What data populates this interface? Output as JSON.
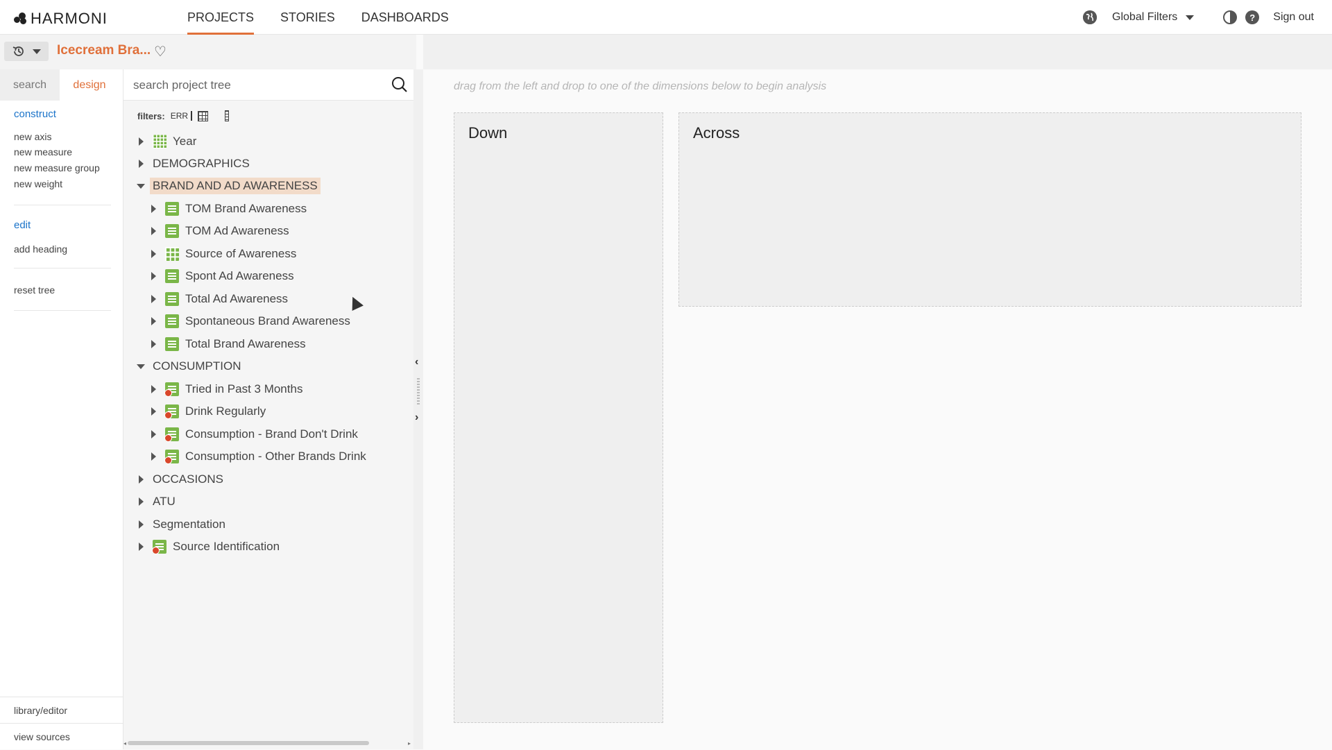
{
  "app": {
    "logo_text": "HARMONI",
    "nav": [
      {
        "label": "PROJECTS",
        "active": true
      },
      {
        "label": "STORIES",
        "active": false
      },
      {
        "label": "DASHBOARDS",
        "active": false
      }
    ],
    "global_filters_label": "Global Filters",
    "sign_out_label": "Sign out",
    "accent_color": "#e0703a",
    "icons": [
      "globe-icon",
      "contrast-icon",
      "help-icon",
      "history-icon",
      "heart-icon",
      "search-icon"
    ]
  },
  "project": {
    "title": "Icecream Bra..."
  },
  "rail": {
    "tabs": [
      {
        "label": "search",
        "active": false
      },
      {
        "label": "design",
        "active": true
      }
    ],
    "construct_label": "construct",
    "construct_items": [
      "new axis",
      "new measure",
      "new measure group",
      "new weight"
    ],
    "edit_label": "edit",
    "edit_items": [
      "add heading"
    ],
    "reset_label": "reset tree",
    "bottom_items": [
      "library/editor",
      "view sources"
    ]
  },
  "tree": {
    "search_placeholder": "search project tree",
    "filters_label": "filters:",
    "filter_err": "ERR",
    "items": [
      {
        "label": "Year",
        "level": 0,
        "expanded": false,
        "icon": "calendar-icon"
      },
      {
        "label": "DEMOGRAPHICS",
        "level": 0,
        "expanded": false,
        "icon": ""
      },
      {
        "label": "BRAND AND AD AWARENESS",
        "level": 0,
        "expanded": true,
        "icon": "",
        "selected": true
      },
      {
        "label": "TOM Brand Awareness",
        "level": 1,
        "expanded": false,
        "icon": "measure-icon"
      },
      {
        "label": "TOM Ad Awareness",
        "level": 1,
        "expanded": false,
        "icon": "measure-icon"
      },
      {
        "label": "Source of Awareness",
        "level": 1,
        "expanded": false,
        "icon": "grid-measure-icon"
      },
      {
        "label": "Spont Ad Awareness",
        "level": 1,
        "expanded": false,
        "icon": "measure-icon"
      },
      {
        "label": "Total Ad Awareness",
        "level": 1,
        "expanded": false,
        "icon": "measure-icon"
      },
      {
        "label": "Spontaneous Brand Awareness",
        "level": 1,
        "expanded": false,
        "icon": "measure-icon"
      },
      {
        "label": "Total Brand Awareness",
        "level": 1,
        "expanded": false,
        "icon": "measure-icon"
      },
      {
        "label": "CONSUMPTION",
        "level": 0,
        "expanded": true,
        "icon": ""
      },
      {
        "label": "Tried in Past 3 Months",
        "level": 1,
        "expanded": false,
        "icon": "measure-error-icon"
      },
      {
        "label": "Drink Regularly",
        "level": 1,
        "expanded": false,
        "icon": "measure-error-icon"
      },
      {
        "label": "Consumption - Brand Don't Drink",
        "level": 1,
        "expanded": false,
        "icon": "measure-error-icon"
      },
      {
        "label": "Consumption - Other Brands Drink",
        "level": 1,
        "expanded": false,
        "icon": "measure-error-icon"
      },
      {
        "label": "OCCASIONS",
        "level": 0,
        "expanded": false,
        "icon": ""
      },
      {
        "label": "ATU",
        "level": 0,
        "expanded": false,
        "icon": ""
      },
      {
        "label": "Segmentation",
        "level": 0,
        "expanded": false,
        "icon": ""
      },
      {
        "label": "Source Identification",
        "level": 0,
        "expanded": false,
        "icon": "measure-error-icon"
      }
    ]
  },
  "analysis": {
    "hint": "drag from the left and drop to one of the dimensions below to begin analysis",
    "down_label": "Down",
    "across_label": "Across"
  }
}
